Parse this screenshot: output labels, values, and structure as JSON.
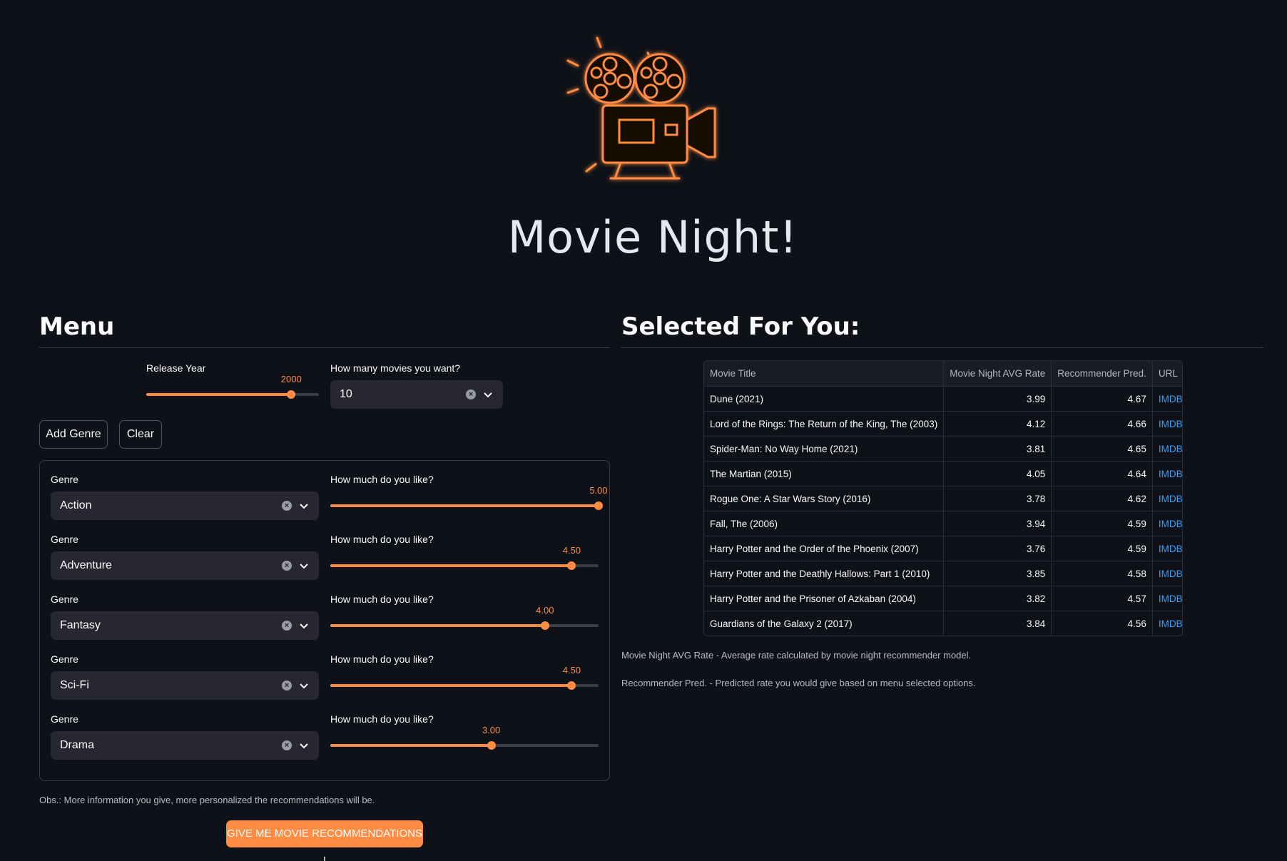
{
  "app": {
    "title": "Movie Night!",
    "logo_icon": "film-camera-icon",
    "accent": "#ff8c42",
    "background": "#0e1117"
  },
  "menu": {
    "title": "Menu",
    "release_year": {
      "label": "Release Year",
      "value": "2000",
      "fraction": 0.84
    },
    "movie_count": {
      "label": "How many movies you want?",
      "value": "10"
    },
    "add_genre_label": "Add Genre",
    "clear_label": "Clear",
    "genres": [
      {
        "genre_label": "Genre",
        "genre": "Action",
        "like_label": "How much do you like?",
        "like_value": "5.00",
        "fraction": 1.0
      },
      {
        "genre_label": "Genre",
        "genre": "Adventure",
        "like_label": "How much do you like?",
        "like_value": "4.50",
        "fraction": 0.9
      },
      {
        "genre_label": "Genre",
        "genre": "Fantasy",
        "like_label": "How much do you like?",
        "like_value": "4.00",
        "fraction": 0.8
      },
      {
        "genre_label": "Genre",
        "genre": "Sci-Fi",
        "like_label": "How much do you like?",
        "like_value": "4.50",
        "fraction": 0.9
      },
      {
        "genre_label": "Genre",
        "genre": "Drama",
        "like_label": "How much do you like?",
        "like_value": "3.00",
        "fraction": 0.6
      }
    ],
    "obs": "Obs.: More information you give, more personalized the recommendations will be.",
    "cta_label": "GIVE ME MOVIE RECOMMENDATIONS !"
  },
  "results": {
    "title": "Selected For You:",
    "columns": [
      "Movie Title",
      "Movie Night AVG Rate",
      "Recommender Pred.",
      "URL"
    ],
    "rows": [
      [
        "Dune (2021)",
        "3.99",
        "4.67",
        "IMDB Link"
      ],
      [
        "Lord of the Rings: The Return of the King, The (2003)",
        "4.12",
        "4.66",
        "IMDB Link"
      ],
      [
        "Spider-Man: No Way Home (2021)",
        "3.81",
        "4.65",
        "IMDB Link"
      ],
      [
        "The Martian (2015)",
        "4.05",
        "4.64",
        "IMDB Link"
      ],
      [
        "Rogue One: A Star Wars Story (2016)",
        "3.78",
        "4.62",
        "IMDB Link"
      ],
      [
        "Fall, The (2006)",
        "3.94",
        "4.59",
        "IMDB Link"
      ],
      [
        "Harry Potter and the Order of the Phoenix (2007)",
        "3.76",
        "4.59",
        "IMDB Link"
      ],
      [
        "Harry Potter and the Deathly Hallows: Part 1 (2010)",
        "3.85",
        "4.58",
        "IMDB Link"
      ],
      [
        "Harry Potter and the Prisoner of Azkaban (2004)",
        "3.82",
        "4.57",
        "IMDB Link"
      ],
      [
        "Guardians of the Galaxy 2 (2017)",
        "3.84",
        "4.56",
        "IMDB Link"
      ]
    ],
    "note_avg": "Movie Night AVG Rate - Average rate calculated by movie night recommender model.",
    "note_pred": "Recommender Pred. - Predicted rate you would give based on menu selected options."
  }
}
